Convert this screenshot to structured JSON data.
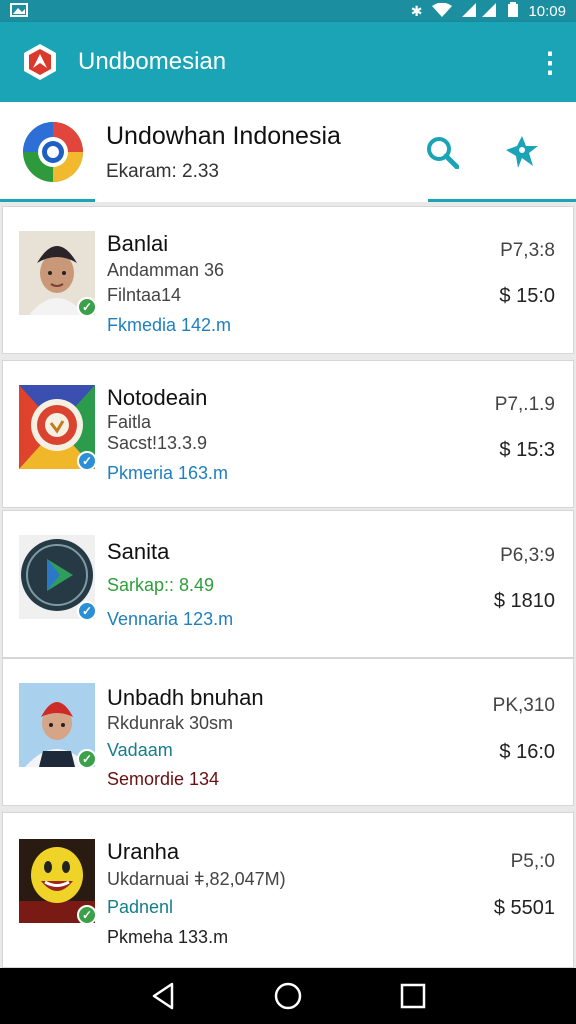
{
  "status_bar": {
    "time": "10:09"
  },
  "app_bar": {
    "title": "Undbomesian",
    "accent": "#1ba3b6"
  },
  "header": {
    "title": "Undowhan Indonesia",
    "subtitle": "Ekaram: 2.33"
  },
  "items": [
    {
      "name": "Banlai",
      "line1": "Andamman 36",
      "line2": "Filntaa14",
      "line3": "Fkmedia 142.m",
      "price_top": "P7,3:8",
      "price_bottom": "$ 15:0"
    },
    {
      "name": "Notodeain",
      "line1": "Faitla",
      "line2": "Sacst!13.3.9",
      "line3": "Pkmeria 163.m",
      "price_top": "P7,.1.9",
      "price_bottom": "$ 15:3"
    },
    {
      "name": "Sanita",
      "line1": "Sarkap:: 8.49",
      "line2": "Vennaria 123.m",
      "price_top": "P6,3:9",
      "price_bottom": "$ 1810"
    },
    {
      "name": "Unbadh bnuhan",
      "line1": "Rkdunrak 30sm",
      "line2": "Vadaam",
      "line3": "Semordie 134",
      "price_top": "PK,310",
      "price_bottom": "$ 16:0"
    },
    {
      "name": "Uranha",
      "line1": "Ukdarnuai ǂ,82,047M)",
      "line2": "Padnenl",
      "line3": "Pkmeha 133.m",
      "price_top": "P5,:0",
      "price_bottom": "$ 5501"
    }
  ]
}
